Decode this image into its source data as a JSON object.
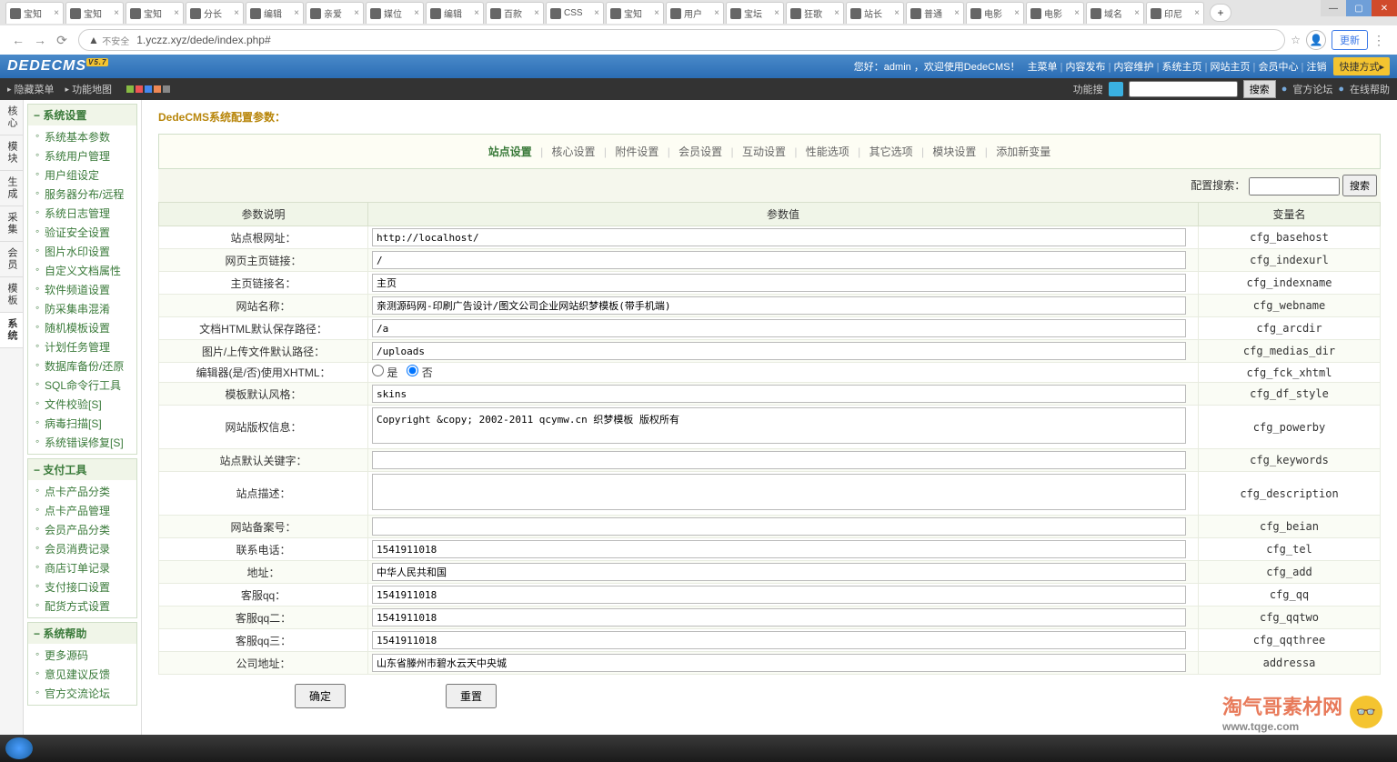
{
  "browser": {
    "tabs": [
      "宝知",
      "宝知",
      "宝知",
      "分长",
      "编辑",
      "亲爱",
      "媒位",
      "编辑",
      "百款",
      "CSS",
      "宝知",
      "用户",
      "宝坛",
      "狂歌",
      "站长",
      "普通",
      "电影",
      "电影",
      "域名",
      "印尼"
    ],
    "active_tab": 19,
    "url": "1.yczz.xyz/dede/index.php#",
    "insecure": "不安全",
    "update_btn": "更新"
  },
  "header": {
    "welcome": "您好：admin ，欢迎使用DedeCMS！",
    "links": [
      "主菜单",
      "内容发布",
      "内容维护",
      "系统主页",
      "网站主页",
      "会员中心",
      "注销"
    ],
    "quick": "快捷方式▸"
  },
  "toolbar": {
    "hide_menu": "隐藏菜单",
    "func_map": "功能地图",
    "search_label": "功能搜",
    "search_btn": "搜索",
    "forum": "官方论坛",
    "help": "在线帮助"
  },
  "side_tabs": [
    "核心",
    "模块",
    "生成",
    "采集",
    "会员",
    "模板",
    "系统"
  ],
  "side_tab_active": 6,
  "sidebar": {
    "s1": {
      "title": "系统设置",
      "items": [
        "系统基本参数",
        "系统用户管理",
        "用户组设定",
        "服务器分布/远程",
        "系统日志管理",
        "验证安全设置",
        "图片水印设置",
        "自定义文档属性",
        "软件频道设置",
        "防采集串混淆",
        "随机模板设置",
        "计划任务管理",
        "数据库备份/还原",
        "SQL命令行工具",
        "文件校验[S]",
        "病毒扫描[S]",
        "系统错误修复[S]"
      ]
    },
    "s2": {
      "title": "支付工具",
      "items": [
        "点卡产品分类",
        "点卡产品管理",
        "会员产品分类",
        "会员消费记录",
        "商店订单记录",
        "支付接口设置",
        "配货方式设置"
      ]
    },
    "s3": {
      "title": "系统帮助",
      "items": [
        "更多源码",
        "意见建议反馈",
        "官方交流论坛"
      ]
    }
  },
  "content": {
    "breadcrumb": "DedeCMS系统配置参数：",
    "tabs": [
      "站点设置",
      "核心设置",
      "附件设置",
      "会员设置",
      "互动设置",
      "性能选项",
      "其它选项",
      "模块设置",
      "添加新变量"
    ],
    "tab_active": 0,
    "cfg_search_label": "配置搜索：",
    "cfg_search_btn": "搜索",
    "th": {
      "desc": "参数说明",
      "val": "参数值",
      "var": "变量名"
    },
    "radio_yes": "是",
    "radio_no": "否",
    "rows": [
      {
        "label": "站点根网址：",
        "value": "http://localhost/",
        "var": "cfg_basehost",
        "type": "text"
      },
      {
        "label": "网页主页链接：",
        "value": "/",
        "var": "cfg_indexurl",
        "type": "text"
      },
      {
        "label": "主页链接名：",
        "value": "主页",
        "var": "cfg_indexname",
        "type": "text"
      },
      {
        "label": "网站名称：",
        "value": "亲测源码网-印刷广告设计/图文公司企业网站织梦模板(带手机端)",
        "var": "cfg_webname",
        "type": "text"
      },
      {
        "label": "文档HTML默认保存路径：",
        "value": "/a",
        "var": "cfg_arcdir",
        "type": "text"
      },
      {
        "label": "图片/上传文件默认路径：",
        "value": "/uploads",
        "var": "cfg_medias_dir",
        "type": "text"
      },
      {
        "label": "编辑器(是/否)使用XHTML：",
        "value": "no",
        "var": "cfg_fck_xhtml",
        "type": "radio"
      },
      {
        "label": "模板默认风格：",
        "value": "skins",
        "var": "cfg_df_style",
        "type": "text"
      },
      {
        "label": "网站版权信息：",
        "value": "Copyright &copy; 2002-2011 qcymw.cn 织梦模板 版权所有",
        "var": "cfg_powerby",
        "type": "textarea",
        "h": 40
      },
      {
        "label": "站点默认关键字：",
        "value": "",
        "var": "cfg_keywords",
        "type": "text"
      },
      {
        "label": "站点描述：",
        "value": "",
        "var": "cfg_description",
        "type": "textarea",
        "h": 40
      },
      {
        "label": "网站备案号：",
        "value": "",
        "var": "cfg_beian",
        "type": "text"
      },
      {
        "label": "联系电话：",
        "value": "1541911018",
        "var": "cfg_tel",
        "type": "text"
      },
      {
        "label": "地址：",
        "value": "中华人民共和国",
        "var": "cfg_add",
        "type": "text"
      },
      {
        "label": "客服qq：",
        "value": "1541911018",
        "var": "cfg_qq",
        "type": "text"
      },
      {
        "label": "客服qq二：",
        "value": "1541911018",
        "var": "cfg_qqtwo",
        "type": "text"
      },
      {
        "label": "客服qq三：",
        "value": "1541911018",
        "var": "cfg_qqthree",
        "type": "text"
      },
      {
        "label": "公司地址：",
        "value": "山东省滕州市碧水云天中央城",
        "var": "addressa",
        "type": "text"
      }
    ],
    "btn_ok": "确定",
    "btn_reset": "重置"
  },
  "watermark": {
    "big": "淘气哥素材网",
    "small": "www.tqge.com"
  }
}
